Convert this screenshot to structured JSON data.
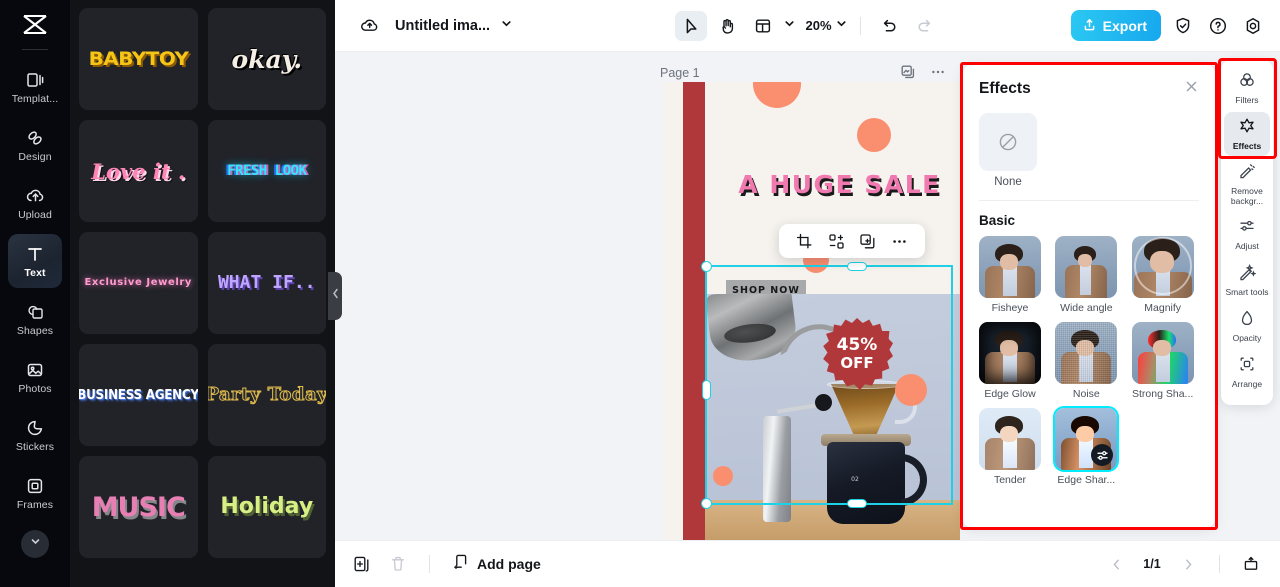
{
  "rail": {
    "logo": "capcut-logo-icon",
    "items": [
      {
        "label": "Templat...",
        "icon": "templates-icon",
        "active": false
      },
      {
        "label": "Design",
        "icon": "design-icon",
        "active": false
      },
      {
        "label": "Upload",
        "icon": "upload-cloud-icon",
        "active": false
      },
      {
        "label": "Text",
        "icon": "text-icon",
        "active": true
      },
      {
        "label": "Shapes",
        "icon": "shapes-icon",
        "active": false
      },
      {
        "label": "Photos",
        "icon": "photos-icon",
        "active": false
      },
      {
        "label": "Stickers",
        "icon": "stickers-icon",
        "active": false
      },
      {
        "label": "Frames",
        "icon": "frames-icon",
        "active": false
      }
    ],
    "more_icon": "chevron-down-icon"
  },
  "templates": {
    "cards": [
      {
        "text": "BABYTOY",
        "style": "t-babytoy"
      },
      {
        "text": "okay.",
        "style": "t-okay"
      },
      {
        "text": "Love it .",
        "style": "t-loveit"
      },
      {
        "text": "FRESH LOOK",
        "style": "t-fresh"
      },
      {
        "text": "Exclusive Jewelry",
        "style": "t-excl"
      },
      {
        "text": "WHAT IF..",
        "style": "t-whatif"
      },
      {
        "text": "BUSINESS AGENCY",
        "style": "t-business"
      },
      {
        "text": "Party Today",
        "style": "t-party"
      },
      {
        "text": "MUSIC",
        "style": "t-music"
      },
      {
        "text": "Holiday",
        "style": "t-holiday"
      }
    ]
  },
  "topbar": {
    "cloud_icon": "cloud-sync-icon",
    "doc_title": "Untitled ima...",
    "title_caret": "chevron-down-icon",
    "tools": [
      {
        "name": "select-tool",
        "icon": "cursor-arrow-icon",
        "selected": true
      },
      {
        "name": "hand-tool",
        "icon": "hand-icon",
        "selected": false
      },
      {
        "name": "layout-tool",
        "icon": "layout-icon",
        "selected": false
      }
    ],
    "zoom_value": "20%",
    "zoom_caret": "chevron-down-icon",
    "undo_icon": "undo-icon",
    "redo_icon": "redo-icon",
    "export_label": "Export",
    "export_icon": "export-upload-icon",
    "export_color": "#1fbdee",
    "right_icons": [
      {
        "name": "shield-check-icon"
      },
      {
        "name": "help-circle-icon"
      },
      {
        "name": "settings-gear-icon"
      }
    ]
  },
  "canvas": {
    "page_label": "Page 1",
    "page_tools": [
      {
        "name": "duplicate-page-icon"
      },
      {
        "name": "page-more-icon"
      }
    ],
    "artboard": {
      "headline": "A HUGE SALE",
      "cta": "SHOP NOW",
      "badge_percent": "45%",
      "badge_off": "OFF"
    },
    "float_toolbar": [
      {
        "name": "crop-icon"
      },
      {
        "name": "replace-image-icon"
      },
      {
        "name": "duplicate-icon"
      },
      {
        "name": "more-options-icon"
      }
    ]
  },
  "effects_panel": {
    "title": "Effects",
    "close_icon": "close-icon",
    "none": {
      "label": "None",
      "icon": "no-effect-icon"
    },
    "section_basic": "Basic",
    "items": [
      {
        "label": "Fisheye",
        "cls": "",
        "selected": false
      },
      {
        "label": "Wide angle",
        "cls": "wide",
        "selected": false
      },
      {
        "label": "Magnify",
        "cls": "magnify",
        "selected": false
      },
      {
        "label": "Edge Glow",
        "cls": "edgeglow",
        "selected": false
      },
      {
        "label": "Noise",
        "cls": "noise",
        "selected": false
      },
      {
        "label": "Strong Sha...",
        "cls": "shatter",
        "selected": false
      },
      {
        "label": "Tender",
        "cls": "tender",
        "selected": false
      },
      {
        "label": "Edge Shar...",
        "cls": "edgeshar",
        "selected": true
      }
    ],
    "adjust_chip_icon": "sliders-icon",
    "highlight_color": "#ff0000"
  },
  "right_rail": {
    "items": [
      {
        "label": "Filters",
        "icon": "filters-icon",
        "selected": false
      },
      {
        "label": "Effects",
        "icon": "effects-star-icon",
        "selected": true
      },
      {
        "label": "Remove backgr...",
        "icon": "remove-bg-icon",
        "selected": false
      },
      {
        "label": "Adjust",
        "icon": "adjust-sliders-icon",
        "selected": false
      },
      {
        "label": "Smart tools",
        "icon": "smart-tools-icon",
        "selected": false
      },
      {
        "label": "Opacity",
        "icon": "opacity-drop-icon",
        "selected": false
      },
      {
        "label": "Arrange",
        "icon": "arrange-icon",
        "selected": false
      }
    ]
  },
  "bottombar": {
    "duplicate_icon": "duplicate-page-icon",
    "delete_icon": "trash-icon",
    "add_page_label": "Add page",
    "add_page_icon": "add-page-icon",
    "prev_icon": "chevron-left-icon",
    "next_icon": "chevron-right-icon",
    "page_indicator": "1/1",
    "present_icon": "present-icon"
  }
}
